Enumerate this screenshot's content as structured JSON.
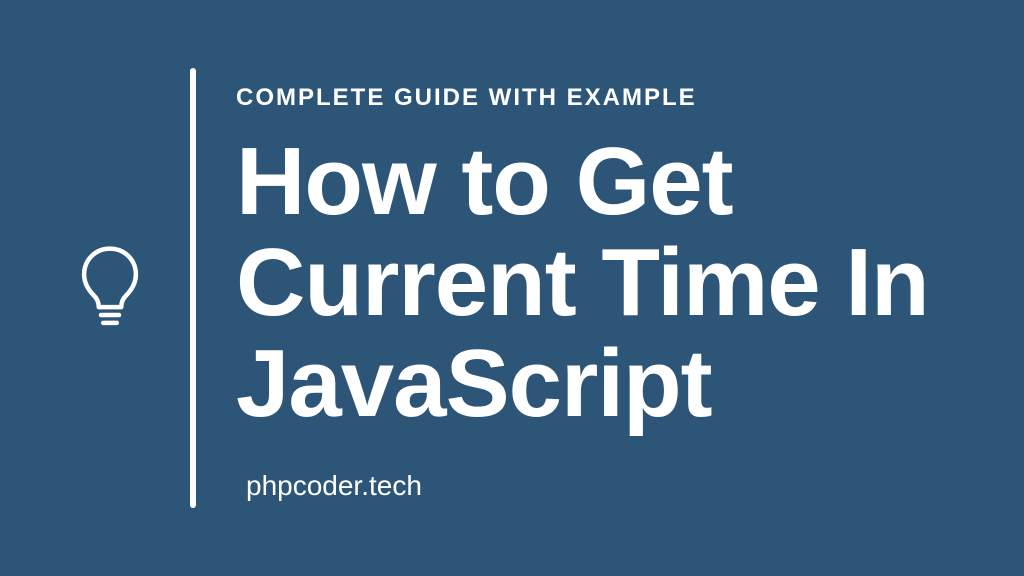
{
  "subtitle": "COMPLETE GUIDE WITH EXAMPLE",
  "title": "How to Get Current Time In JavaScript",
  "footer": "phpcoder.tech",
  "colors": {
    "background": "#2d5578",
    "text": "#ffffff"
  }
}
